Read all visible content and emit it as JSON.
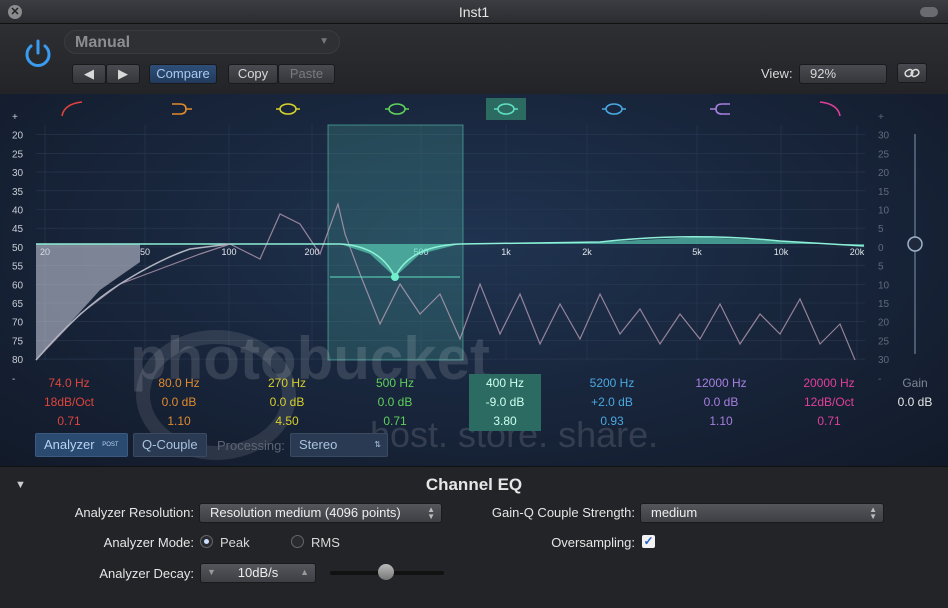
{
  "window": {
    "title": "Inst1"
  },
  "preset": {
    "value": "Manual"
  },
  "toolbar": {
    "prev": "◀",
    "next": "▶",
    "compare": "Compare",
    "copy": "Copy",
    "paste": "Paste",
    "view_label": "View:",
    "view_value": "92%"
  },
  "axis": {
    "left_db": [
      "+",
      "20",
      "25",
      "30",
      "35",
      "40",
      "45",
      "50",
      "55",
      "60",
      "65",
      "70",
      "75",
      "80",
      "-"
    ],
    "right_db": [
      "+",
      "30",
      "25",
      "20",
      "15",
      "10",
      "5",
      "0",
      "5",
      "10",
      "15",
      "20",
      "25",
      "30",
      "-"
    ],
    "freq": [
      "20",
      "50",
      "100",
      "200",
      "500",
      "1k",
      "2k",
      "5k",
      "10k",
      "20k"
    ]
  },
  "bands": [
    {
      "freq": "74.0 Hz",
      "gain": "18dB/Oct",
      "q": "0.71",
      "color": "#e0443c"
    },
    {
      "freq": "80.0 Hz",
      "gain": "0.0 dB",
      "q": "1.10",
      "color": "#e08a2c"
    },
    {
      "freq": "270 Hz",
      "gain": "0.0 dB",
      "q": "4.50",
      "color": "#d8cf2a"
    },
    {
      "freq": "500 Hz",
      "gain": "0.0 dB",
      "q": "0.71",
      "color": "#5fd05a"
    },
    {
      "freq": "400 Hz",
      "gain": "-9.0 dB",
      "q": "3.80",
      "color": "#5fe0c0"
    },
    {
      "freq": "5200 Hz",
      "gain": "+2.0 dB",
      "q": "0.93",
      "color": "#4aa8e0"
    },
    {
      "freq": "12000 Hz",
      "gain": "0.0 dB",
      "q": "1.10",
      "color": "#a77fe0"
    },
    {
      "freq": "20000 Hz",
      "gain": "12dB/Oct",
      "q": "0.71",
      "color": "#e0409a"
    }
  ],
  "gain": {
    "label": "Gain",
    "value": "0.0 dB"
  },
  "analyzer": {
    "button": "Analyzer",
    "post": "POST",
    "qcouple": "Q-Couple",
    "processing_label": "Processing:",
    "processing_value": "Stereo"
  },
  "plugin_name": "Channel EQ",
  "settings": {
    "res_label": "Analyzer Resolution:",
    "res_value": "Resolution medium (4096 points)",
    "gainq_label": "Gain-Q Couple Strength:",
    "gainq_value": "medium",
    "mode_label": "Analyzer Mode:",
    "mode_peak": "Peak",
    "mode_rms": "RMS",
    "oversampling_label": "Oversampling:",
    "decay_label": "Analyzer Decay:",
    "decay_value": "10dB/s"
  },
  "watermark": {
    "line1": "photobucket",
    "line2": "host. store. share."
  }
}
